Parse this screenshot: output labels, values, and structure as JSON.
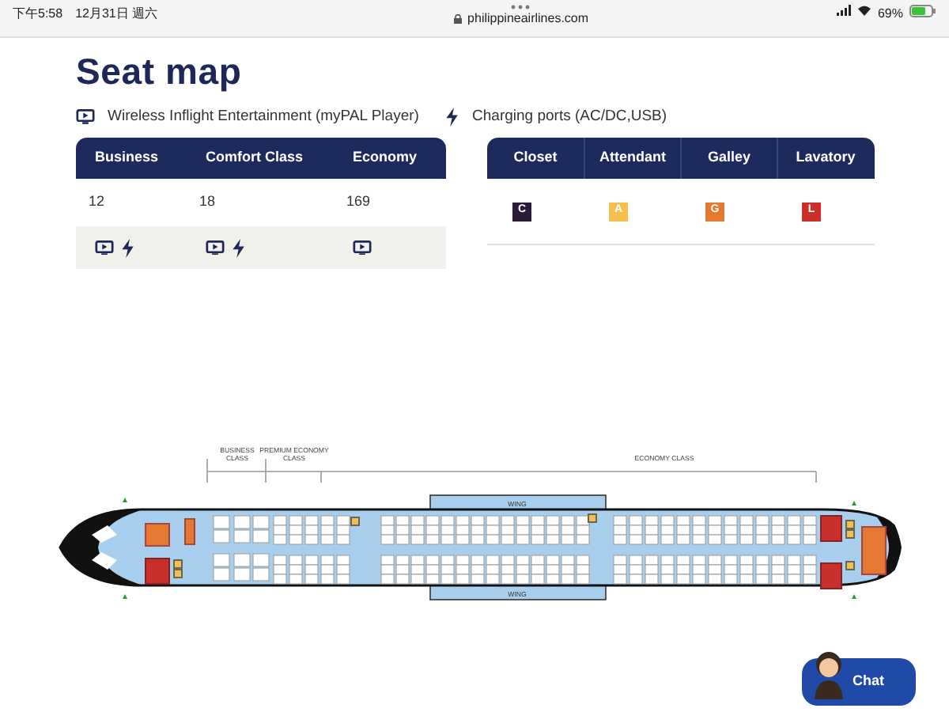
{
  "status_bar": {
    "time": "下午5:58",
    "date": "12月31日 週六",
    "url": "philippineairlines.com",
    "battery": "69%"
  },
  "title": "Seat map",
  "legend": [
    {
      "kind": "entertainment",
      "label": "Wireless Inflight Entertainment (myPAL Player)"
    },
    {
      "kind": "charging",
      "label": "Charging ports (AC/DC,USB)"
    }
  ],
  "class_table": {
    "columns": [
      "Business",
      "Comfort Class",
      "Economy"
    ],
    "seats": [
      "12",
      "18",
      "169"
    ],
    "amenities": [
      [
        {
          "kind": "entertainment"
        },
        {
          "kind": "charging"
        }
      ],
      [
        {
          "kind": "entertainment"
        },
        {
          "kind": "charging"
        }
      ],
      [
        {
          "kind": "entertainment"
        }
      ]
    ]
  },
  "facility_table": {
    "columns": [
      "Closet",
      "Attendant",
      "Galley",
      "Lavatory"
    ],
    "badges": [
      {
        "letter": "C",
        "color": "#2b1a38"
      },
      {
        "letter": "A",
        "color": "#f5bf4f"
      },
      {
        "letter": "G",
        "color": "#e47a32"
      },
      {
        "letter": "L",
        "color": "#c9302c"
      }
    ]
  },
  "seat_map": {
    "sections": [
      "BUSINESS CLASS",
      "PREMIUM ECONOMY CLASS",
      "ECONOMY CLASS"
    ],
    "wings": [
      "WING",
      "WING"
    ]
  },
  "chat": {
    "label": "Chat"
  }
}
